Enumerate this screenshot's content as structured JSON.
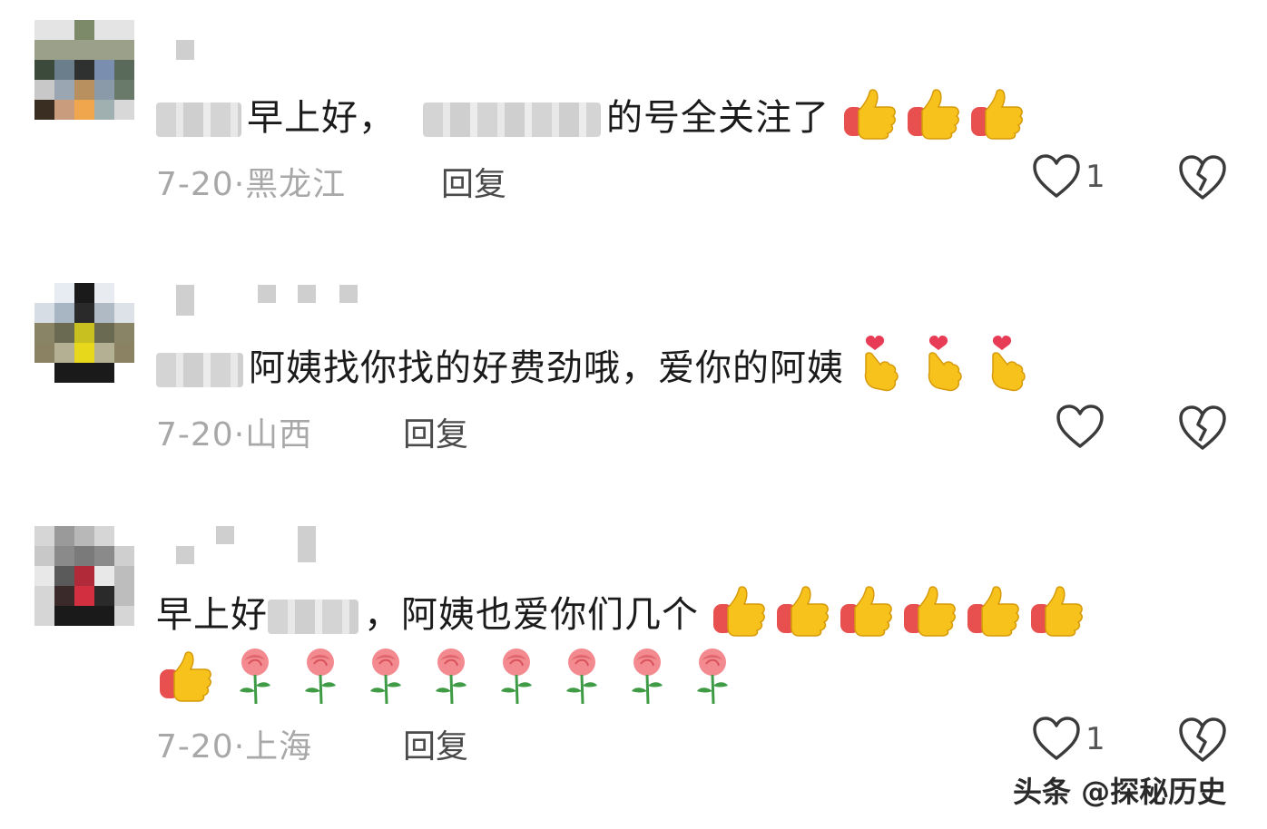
{
  "comments": [
    {
      "prefix_text": "早上好，",
      "suffix_text": "的号全关注了",
      "emoji": "thumbs-up-icon",
      "emoji_count": 3,
      "date": "7-20·",
      "location": "黑龙江",
      "reply_label": "回复",
      "like_count": "1"
    },
    {
      "prefix_text": "",
      "suffix_text": "阿姨找你找的好费劲哦，爱你的阿姨",
      "emoji": "finger-heart-icon",
      "emoji_count": 3,
      "date": "7-20·",
      "location": "山西",
      "reply_label": "回复",
      "like_count": ""
    },
    {
      "prefix_text": "早上好",
      "suffix_text": "，阿姨也爱你们几个",
      "emoji": "thumbs-up-icon",
      "emoji_count": 7,
      "emoji2": "rose-icon",
      "emoji2_count": 8,
      "date": "7-20·",
      "location": "上海",
      "reply_label": "回复",
      "like_count": "1"
    }
  ],
  "watermark": "头条 @探秘历史",
  "colors": {
    "text": "#1b1b1b",
    "meta": "#a8a8a8",
    "thumb_yellow": "#f7c21c",
    "thumb_red": "#e8504f",
    "heart_red": "#e83b55",
    "rose_pink": "#f28a8f",
    "stem_green": "#3f9b46"
  }
}
